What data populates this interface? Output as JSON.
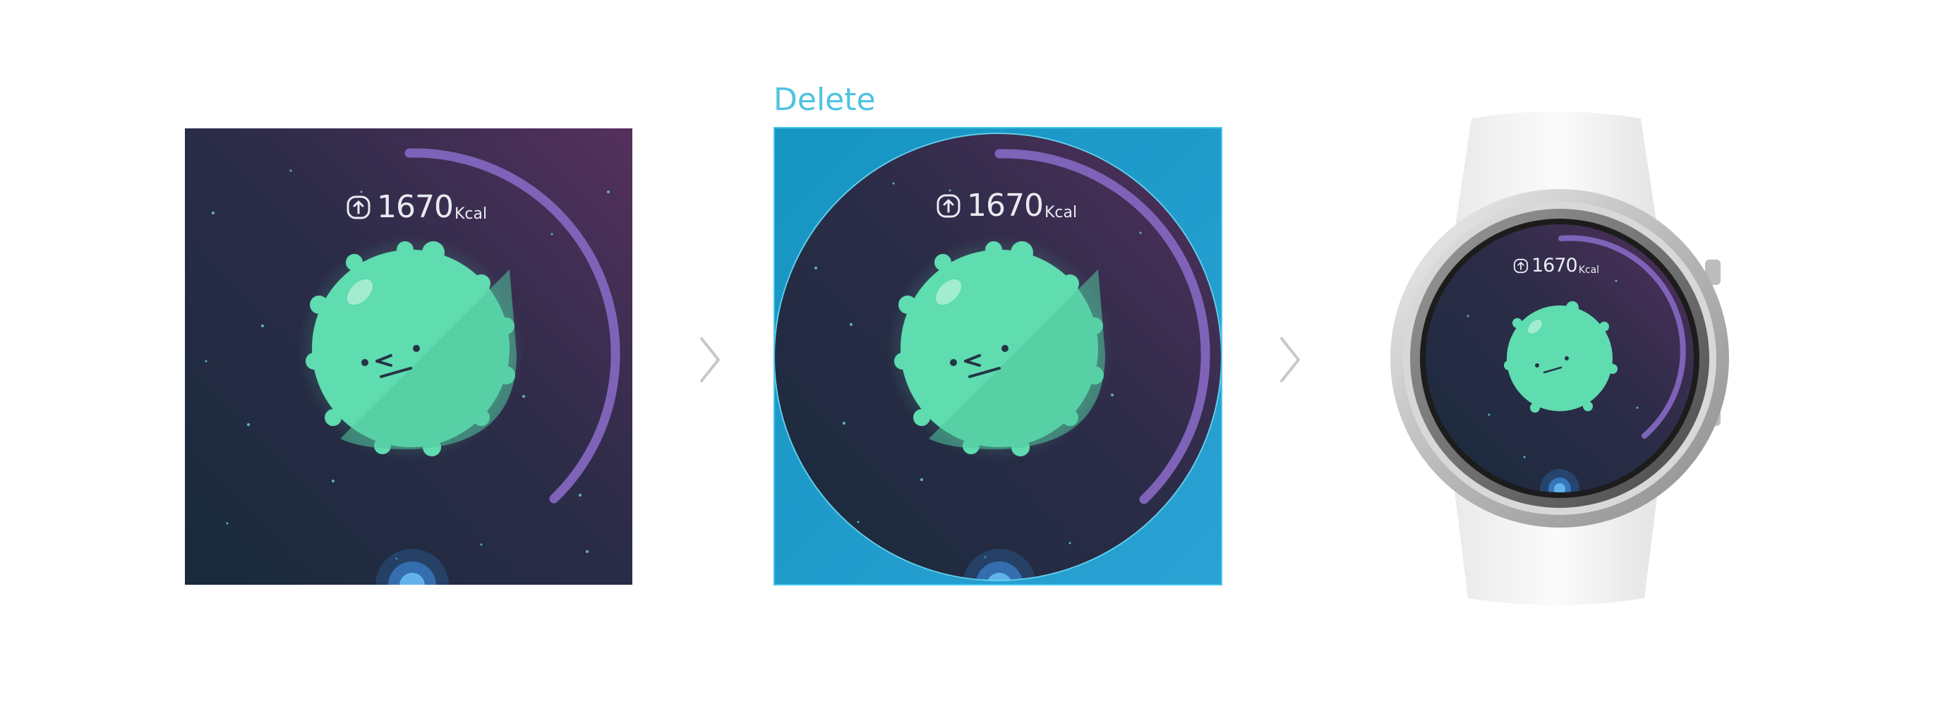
{
  "steps": [
    {
      "id": "square",
      "calories_value": "1670",
      "calories_unit": "Kcal",
      "icon": "arrow-up-circle-icon"
    },
    {
      "id": "circle-mask",
      "label": "Delete",
      "calories_value": "1670",
      "calories_unit": "Kcal",
      "icon": "arrow-up-circle-icon"
    },
    {
      "id": "watch-preview",
      "calories_value": "1670",
      "calories_unit": "Kcal",
      "icon": "arrow-up-circle-icon"
    }
  ],
  "separators": [
    "chevron-right-icon",
    "chevron-right-icon"
  ],
  "colors": {
    "delete_accent": "#4ec3e0",
    "background_top": "#4a2d5a",
    "background_bottom": "#1b2c3e",
    "character": "#5fdcb0",
    "progress_arc": "#8a6bc0",
    "mask_area": "#1a9fcb"
  },
  "progress_fraction": 0.45
}
